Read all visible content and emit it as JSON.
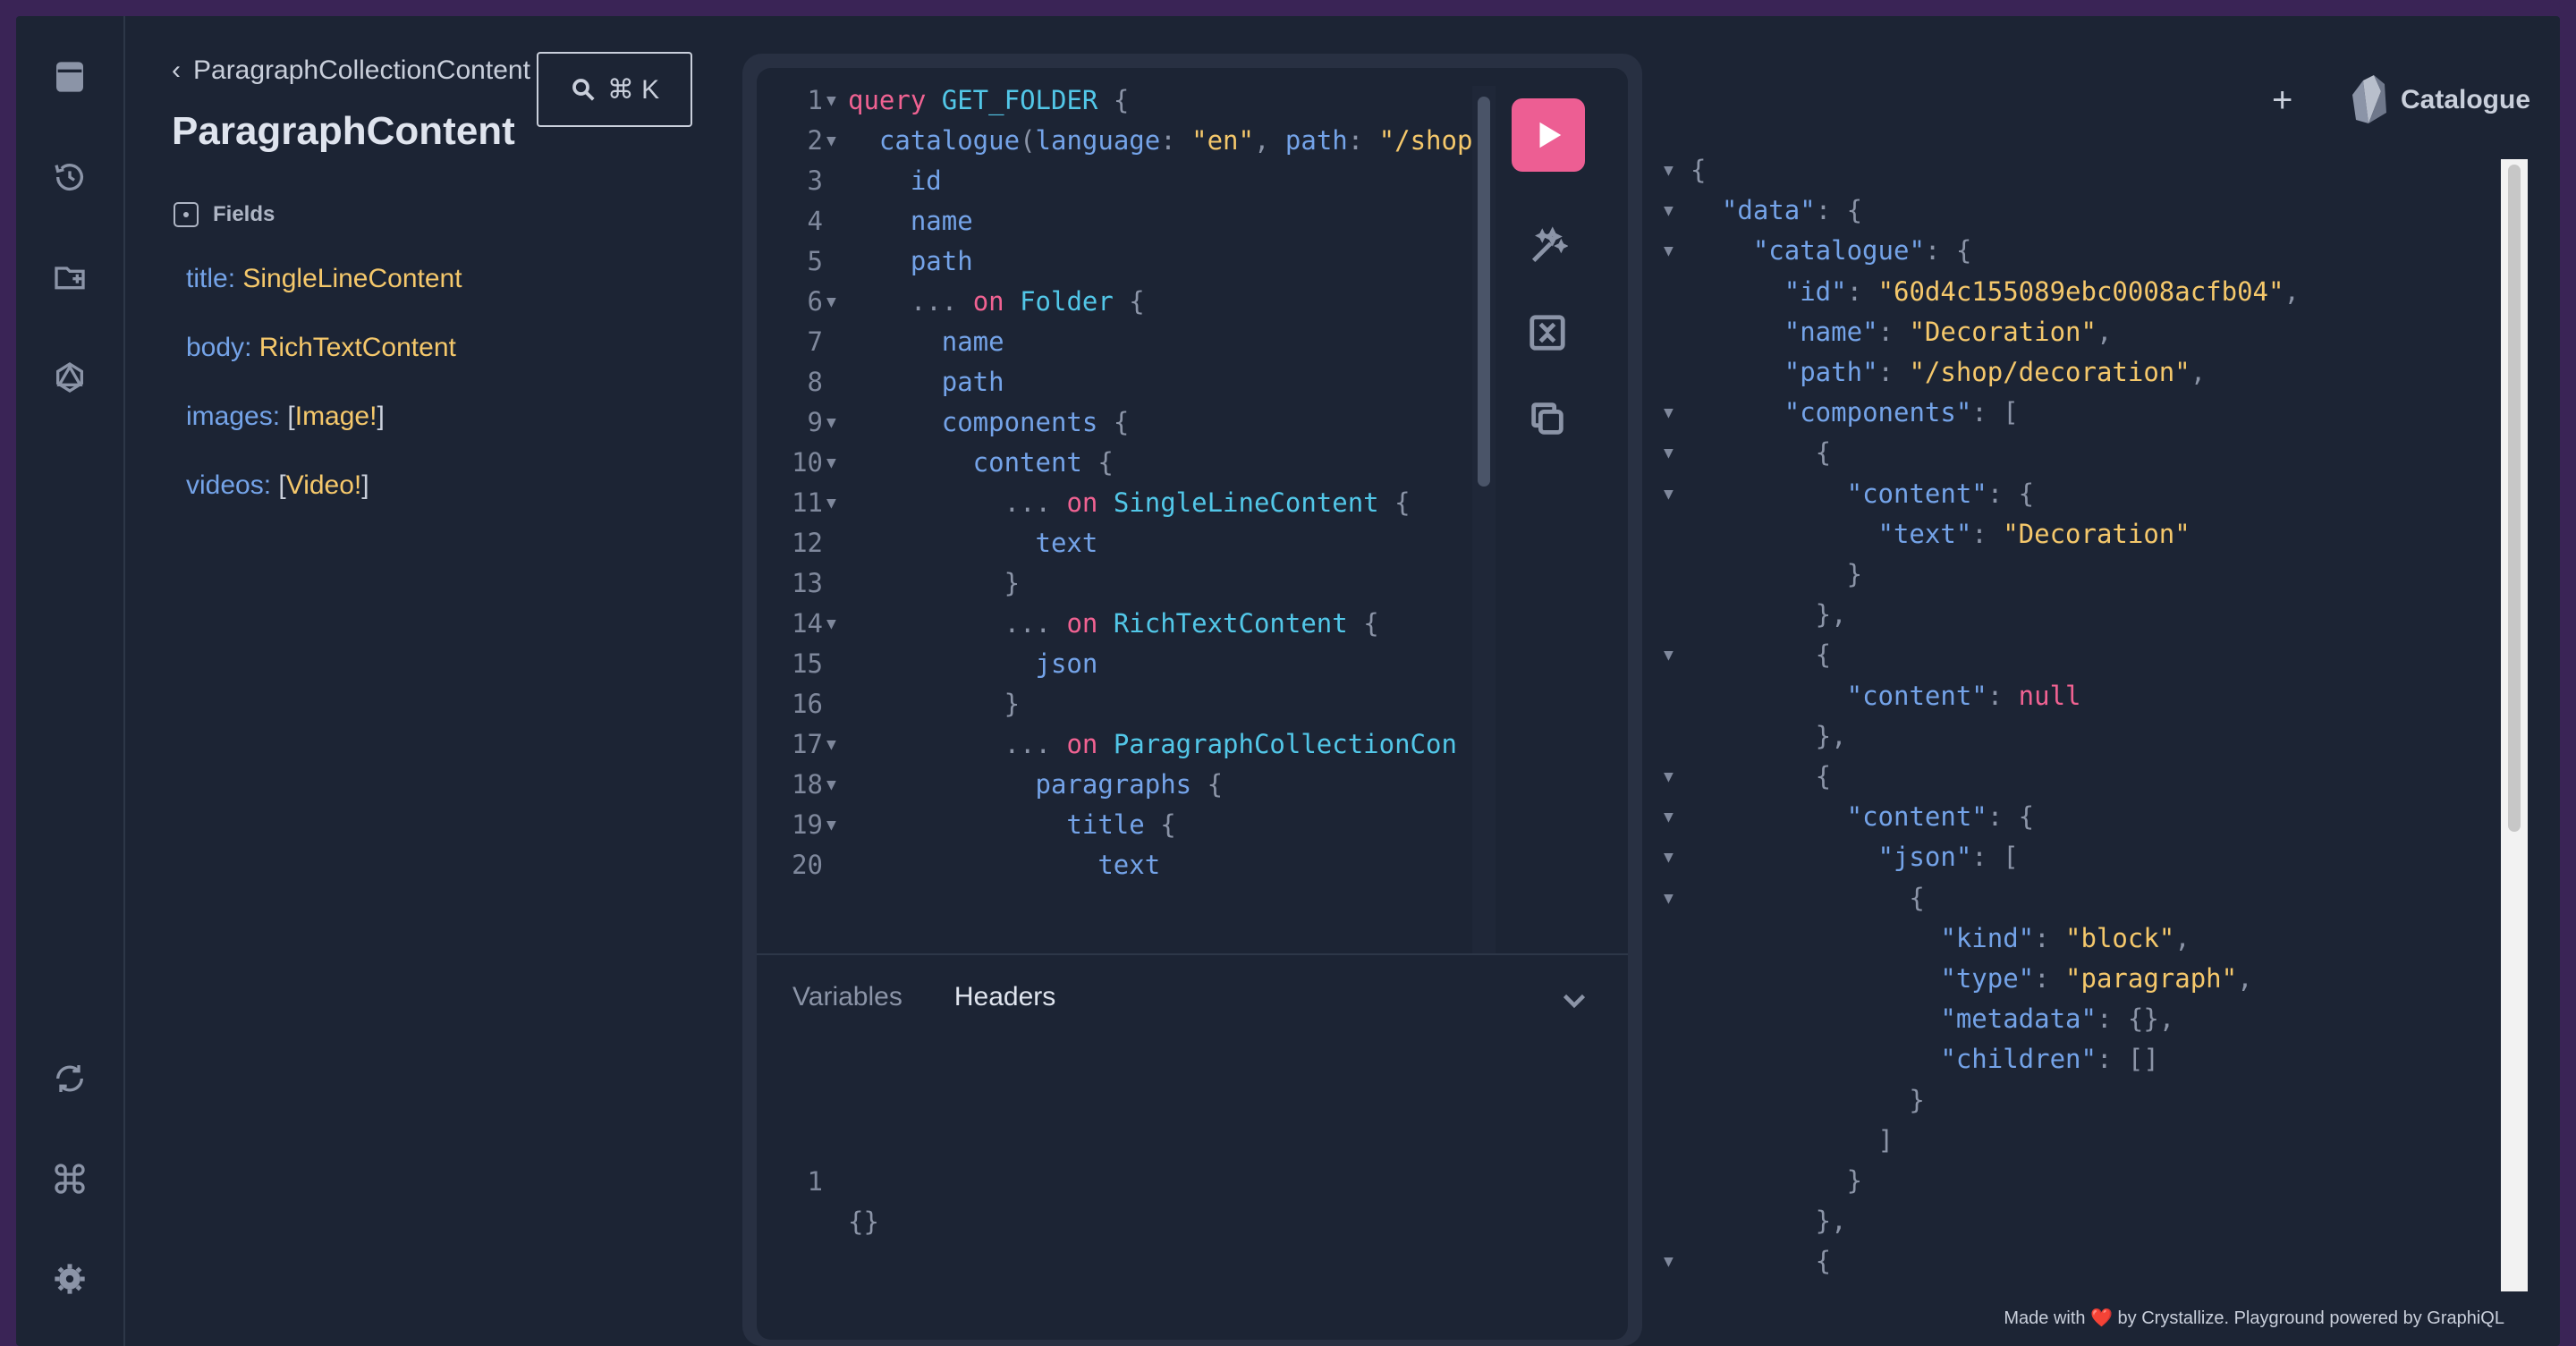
{
  "rail": {
    "icons": [
      "docs-icon",
      "history-icon",
      "collections-icon",
      "schema-icon",
      "refresh-icon",
      "command-icon",
      "settings-icon"
    ]
  },
  "docs": {
    "back_label": "ParagraphCollectionContent",
    "search_shortcut": "⌘ K",
    "title": "ParagraphContent",
    "fields_label": "Fields",
    "fields": [
      {
        "name": "title",
        "sep": ": ",
        "open": "",
        "type": "SingleLineContent",
        "close": ""
      },
      {
        "name": "body",
        "sep": ": ",
        "open": "",
        "type": "RichTextContent",
        "close": ""
      },
      {
        "name": "images",
        "sep": ": ",
        "open": "[",
        "type": "Image!",
        "close": "]"
      },
      {
        "name": "videos",
        "sep": ": ",
        "open": "[",
        "type": "Video!",
        "close": "]"
      }
    ]
  },
  "editor": {
    "lines": [
      {
        "n": "1",
        "fold": true,
        "tokens": [
          [
            "kw",
            "query "
          ],
          [
            "def",
            "GET_FOLDER"
          ],
          [
            "pun",
            " {"
          ]
        ]
      },
      {
        "n": "2",
        "fold": true,
        "tokens": [
          [
            "field-c",
            "  catalogue"
          ],
          [
            "pun",
            "("
          ],
          [
            "argn",
            "language"
          ],
          [
            "pun",
            ": "
          ],
          [
            "str",
            "\"en\""
          ],
          [
            "pun",
            ", "
          ],
          [
            "argn",
            "path"
          ],
          [
            "pun",
            ": "
          ],
          [
            "str",
            "\"/shop"
          ]
        ]
      },
      {
        "n": "3",
        "fold": false,
        "tokens": [
          [
            "field-c",
            "    id"
          ]
        ]
      },
      {
        "n": "4",
        "fold": false,
        "tokens": [
          [
            "field-c",
            "    name"
          ]
        ]
      },
      {
        "n": "5",
        "fold": false,
        "tokens": [
          [
            "field-c",
            "    path"
          ]
        ]
      },
      {
        "n": "6",
        "fold": true,
        "tokens": [
          [
            "pun",
            "    ... "
          ],
          [
            "kw",
            "on "
          ],
          [
            "def",
            "Folder"
          ],
          [
            "pun",
            " {"
          ]
        ]
      },
      {
        "n": "7",
        "fold": false,
        "tokens": [
          [
            "field-c",
            "      name"
          ]
        ]
      },
      {
        "n": "8",
        "fold": false,
        "tokens": [
          [
            "field-c",
            "      path"
          ]
        ]
      },
      {
        "n": "9",
        "fold": true,
        "tokens": [
          [
            "field-c",
            "      components"
          ],
          [
            "pun",
            " {"
          ]
        ]
      },
      {
        "n": "10",
        "fold": true,
        "tokens": [
          [
            "field-c",
            "        content"
          ],
          [
            "pun",
            " {"
          ]
        ]
      },
      {
        "n": "11",
        "fold": true,
        "tokens": [
          [
            "pun",
            "          ... "
          ],
          [
            "kw",
            "on "
          ],
          [
            "def",
            "SingleLineContent"
          ],
          [
            "pun",
            " {"
          ]
        ]
      },
      {
        "n": "12",
        "fold": false,
        "tokens": [
          [
            "field-c",
            "            text"
          ]
        ]
      },
      {
        "n": "13",
        "fold": false,
        "tokens": [
          [
            "pun",
            "          }"
          ]
        ]
      },
      {
        "n": "14",
        "fold": true,
        "tokens": [
          [
            "pun",
            "          ... "
          ],
          [
            "kw",
            "on "
          ],
          [
            "def",
            "RichTextContent"
          ],
          [
            "pun",
            " {"
          ]
        ]
      },
      {
        "n": "15",
        "fold": false,
        "tokens": [
          [
            "field-c",
            "            json"
          ]
        ]
      },
      {
        "n": "16",
        "fold": false,
        "tokens": [
          [
            "pun",
            "          }"
          ]
        ]
      },
      {
        "n": "17",
        "fold": true,
        "tokens": [
          [
            "pun",
            "          ... "
          ],
          [
            "kw",
            "on "
          ],
          [
            "def",
            "ParagraphCollectionCon"
          ]
        ]
      },
      {
        "n": "18",
        "fold": true,
        "tokens": [
          [
            "field-c",
            "            paragraphs"
          ],
          [
            "pun",
            " {"
          ]
        ]
      },
      {
        "n": "19",
        "fold": true,
        "tokens": [
          [
            "field-c",
            "              title"
          ],
          [
            "pun",
            " {"
          ]
        ]
      },
      {
        "n": "20",
        "fold": false,
        "tokens": [
          [
            "field-c",
            "                text"
          ]
        ]
      }
    ],
    "tabs": {
      "variables": "Variables",
      "headers": "Headers"
    },
    "variables_line": {
      "n": "1",
      "text": "{}"
    }
  },
  "result": {
    "brand": "Catalogue",
    "plus": "+",
    "lines": [
      {
        "fold": true,
        "tokens": [
          [
            "pun",
            "{"
          ]
        ]
      },
      {
        "fold": true,
        "tokens": [
          [
            "pun",
            "  "
          ],
          [
            "key",
            "\"data\""
          ],
          [
            "pun",
            ": {"
          ]
        ]
      },
      {
        "fold": true,
        "tokens": [
          [
            "pun",
            "    "
          ],
          [
            "key",
            "\"catalogue\""
          ],
          [
            "pun",
            ": {"
          ]
        ]
      },
      {
        "fold": false,
        "tokens": [
          [
            "pun",
            "      "
          ],
          [
            "key",
            "\"id\""
          ],
          [
            "pun",
            ": "
          ],
          [
            "jstr",
            "\"60d4c155089ebc0008acfb04\""
          ],
          [
            "pun",
            ","
          ]
        ]
      },
      {
        "fold": false,
        "tokens": [
          [
            "pun",
            "      "
          ],
          [
            "key",
            "\"name\""
          ],
          [
            "pun",
            ": "
          ],
          [
            "jstr",
            "\"Decoration\""
          ],
          [
            "pun",
            ","
          ]
        ]
      },
      {
        "fold": false,
        "tokens": [
          [
            "pun",
            "      "
          ],
          [
            "key",
            "\"path\""
          ],
          [
            "pun",
            ": "
          ],
          [
            "jstr",
            "\"/shop/decoration\""
          ],
          [
            "pun",
            ","
          ]
        ]
      },
      {
        "fold": true,
        "tokens": [
          [
            "pun",
            "      "
          ],
          [
            "key",
            "\"components\""
          ],
          [
            "pun",
            ": ["
          ]
        ]
      },
      {
        "fold": true,
        "tokens": [
          [
            "pun",
            "        {"
          ]
        ]
      },
      {
        "fold": true,
        "tokens": [
          [
            "pun",
            "          "
          ],
          [
            "key",
            "\"content\""
          ],
          [
            "pun",
            ": {"
          ]
        ]
      },
      {
        "fold": false,
        "tokens": [
          [
            "pun",
            "            "
          ],
          [
            "key",
            "\"text\""
          ],
          [
            "pun",
            ": "
          ],
          [
            "jstr",
            "\"Decoration\""
          ]
        ]
      },
      {
        "fold": false,
        "tokens": [
          [
            "pun",
            "          }"
          ]
        ]
      },
      {
        "fold": false,
        "tokens": [
          [
            "pun",
            "        },"
          ]
        ]
      },
      {
        "fold": true,
        "tokens": [
          [
            "pun",
            "        {"
          ]
        ]
      },
      {
        "fold": false,
        "tokens": [
          [
            "pun",
            "          "
          ],
          [
            "key",
            "\"content\""
          ],
          [
            "pun",
            ": "
          ],
          [
            "jnull",
            "null"
          ]
        ]
      },
      {
        "fold": false,
        "tokens": [
          [
            "pun",
            "        },"
          ]
        ]
      },
      {
        "fold": true,
        "tokens": [
          [
            "pun",
            "        {"
          ]
        ]
      },
      {
        "fold": true,
        "tokens": [
          [
            "pun",
            "          "
          ],
          [
            "key",
            "\"content\""
          ],
          [
            "pun",
            ": {"
          ]
        ]
      },
      {
        "fold": true,
        "tokens": [
          [
            "pun",
            "            "
          ],
          [
            "key",
            "\"json\""
          ],
          [
            "pun",
            ": ["
          ]
        ]
      },
      {
        "fold": true,
        "tokens": [
          [
            "pun",
            "              {"
          ]
        ]
      },
      {
        "fold": false,
        "tokens": [
          [
            "pun",
            "                "
          ],
          [
            "key",
            "\"kind\""
          ],
          [
            "pun",
            ": "
          ],
          [
            "jstr",
            "\"block\""
          ],
          [
            "pun",
            ","
          ]
        ]
      },
      {
        "fold": false,
        "tokens": [
          [
            "pun",
            "                "
          ],
          [
            "key",
            "\"type\""
          ],
          [
            "pun",
            ": "
          ],
          [
            "jstr",
            "\"paragraph\""
          ],
          [
            "pun",
            ","
          ]
        ]
      },
      {
        "fold": false,
        "tokens": [
          [
            "pun",
            "                "
          ],
          [
            "key",
            "\"metadata\""
          ],
          [
            "pun",
            ": {},"
          ]
        ]
      },
      {
        "fold": false,
        "tokens": [
          [
            "pun",
            "                "
          ],
          [
            "key",
            "\"children\""
          ],
          [
            "pun",
            ": []"
          ]
        ]
      },
      {
        "fold": false,
        "tokens": [
          [
            "pun",
            "              }"
          ]
        ]
      },
      {
        "fold": false,
        "tokens": [
          [
            "pun",
            "            ]"
          ]
        ]
      },
      {
        "fold": false,
        "tokens": [
          [
            "pun",
            "          }"
          ]
        ]
      },
      {
        "fold": false,
        "tokens": [
          [
            "pun",
            "        },"
          ]
        ]
      },
      {
        "fold": true,
        "tokens": [
          [
            "pun",
            "        {"
          ]
        ]
      }
    ]
  },
  "footer": {
    "before": "Made with ",
    "heart": "❤️",
    "after": " by Crystallize. Playground powered by GraphiQL"
  },
  "colors": {
    "accent": "#ed5e93",
    "background": "#1c2434",
    "frame": "#3a2456",
    "type": "#f5c86b",
    "field": "#74a3e8"
  }
}
